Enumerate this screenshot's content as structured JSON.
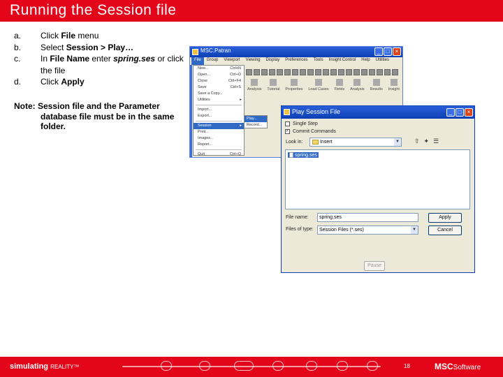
{
  "title": "Running the Session file",
  "steps": [
    {
      "letter": "a.",
      "pre": "Click ",
      "bold": "File",
      "post": " menu"
    },
    {
      "letter": "b.",
      "pre": "Select ",
      "bold": "Session > Play…",
      "post": ""
    },
    {
      "letter": "c.",
      "pre": "In ",
      "bold": "File Name",
      "mid": " enter ",
      "italic": "spring.ses",
      "post": " or click the file"
    },
    {
      "letter": "d.",
      "pre": "Click ",
      "bold": "Apply",
      "post": ""
    }
  ],
  "note": {
    "line1": "Note: Session file and the Parameter",
    "rest": "database file must be in the same folder."
  },
  "patran_window": {
    "title": "MSC.Patran",
    "menubar": [
      "File",
      "Group",
      "Viewport",
      "Viewing",
      "Display",
      "Preferences",
      "Tools",
      "Insight Control",
      "Help",
      "Utilities"
    ],
    "file_menu": [
      {
        "label": "New...",
        "shortcut": "Ctrl+N"
      },
      {
        "label": "Open...",
        "shortcut": "Ctrl+O"
      },
      {
        "label": "Close",
        "shortcut": "Ctrl+F4"
      },
      {
        "label": "Save",
        "shortcut": "Ctrl+S"
      },
      {
        "label": "Save a Copy...",
        "shortcut": ""
      },
      {
        "label": "Utilities",
        "shortcut": ""
      },
      {
        "label": "Import...",
        "shortcut": ""
      },
      {
        "label": "Export...",
        "shortcut": ""
      },
      {
        "label": "Session",
        "shortcut": ""
      },
      {
        "label": "Print...",
        "shortcut": ""
      },
      {
        "label": "Images...",
        "shortcut": ""
      },
      {
        "label": "Report...",
        "shortcut": ""
      },
      {
        "label": "Quit",
        "shortcut": "Ctrl+Q"
      }
    ],
    "session_submenu": [
      "Play...",
      "Record..."
    ],
    "apps": [
      "Analysis",
      "Tutorial",
      "Properties",
      "Load Cases",
      "Fields",
      "Analysis",
      "Results",
      "Insight"
    ]
  },
  "dialog": {
    "title": "Play Session File",
    "checkbox_single_step": "Single Step",
    "checkbox_commit": "Commit Commands",
    "commit_checked": "✓",
    "lookin_label": "Look in:",
    "lookin_value": "Insert",
    "file_item": "spring.ses",
    "filename_label": "File name:",
    "filename_value": "spring.ses",
    "filetype_label": "Files of type:",
    "filetype_value": "Session Files (*.ses)",
    "apply_label": "Apply",
    "cancel_label": "Cancel",
    "pause_label": "Pause"
  },
  "footer": {
    "brand": "simulating",
    "brand_tail": "REALITY™",
    "page": "18",
    "logo": "MSC",
    "logo_tail": "Software"
  }
}
